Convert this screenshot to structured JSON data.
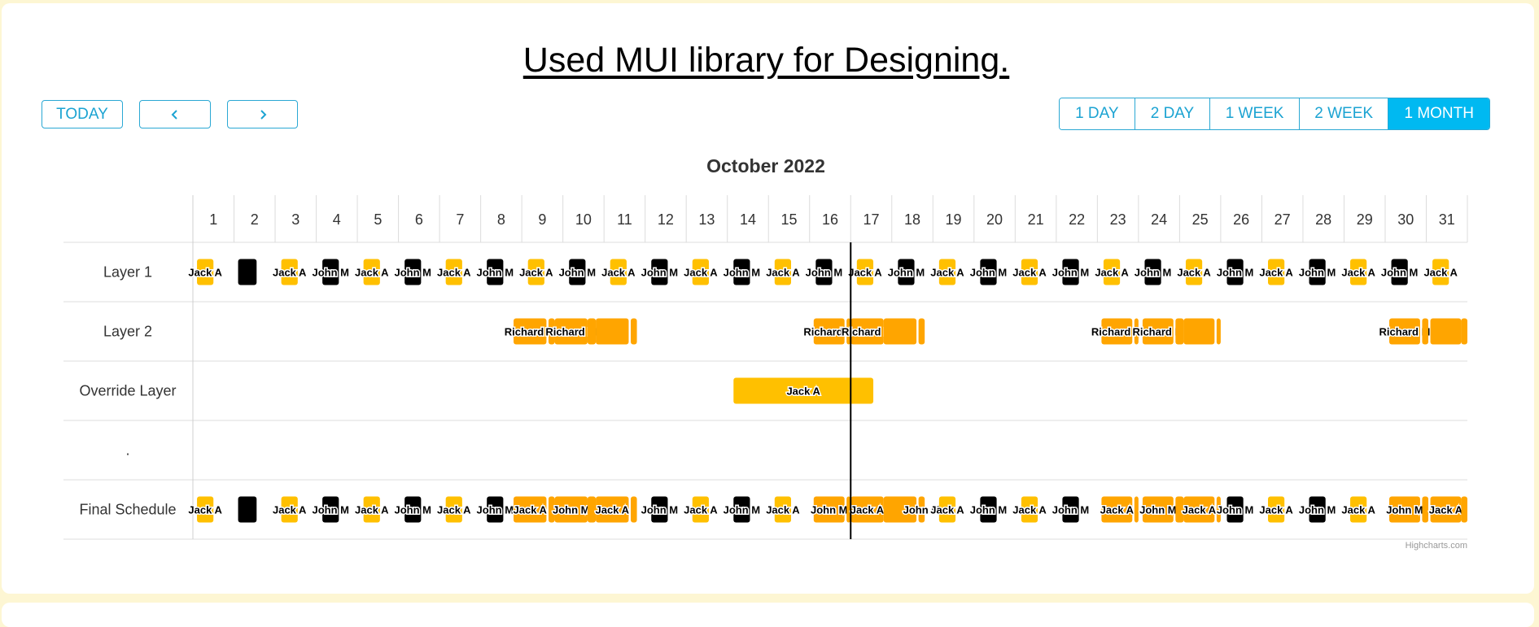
{
  "header": {
    "title": "Used MUI library for Designing."
  },
  "nav": {
    "today_label": "TODAY",
    "prev_icon": "chevron-left-icon",
    "next_icon": "chevron-right-icon"
  },
  "range_toggle": {
    "options": [
      "1 DAY",
      "2 DAY",
      "1 WEEK",
      "2 WEEK",
      "1 MONTH"
    ],
    "selected": "1 MONTH"
  },
  "colors": {
    "accent": "#00b9f1",
    "jack": "#ffc000",
    "john": "#000000",
    "richard": "#ffa500",
    "today_line": "#000000"
  },
  "credits": "Highcharts.com",
  "chart_data": {
    "type": "gantt",
    "title": "October 2022",
    "x_unit": "day of October 2022",
    "x_range": [
      1,
      32
    ],
    "days": [
      1,
      2,
      3,
      4,
      5,
      6,
      7,
      8,
      9,
      10,
      11,
      12,
      13,
      14,
      15,
      16,
      17,
      18,
      19,
      20,
      21,
      22,
      23,
      24,
      25,
      26,
      27,
      28,
      29,
      30,
      31
    ],
    "current_date_line": 17,
    "rows": [
      "Layer 1",
      "Layer 2",
      "Override Layer",
      ".",
      "Final Schedule"
    ],
    "series": [
      {
        "name": "Layer 1",
        "row": 0,
        "tasks": [
          {
            "label": "Jack A",
            "start": 1.1,
            "end": 1.5,
            "person": "jack"
          },
          {
            "label": "",
            "start": 2.1,
            "end": 2.55,
            "person": "john"
          },
          {
            "label": "Jack A",
            "start": 3.15,
            "end": 3.55,
            "person": "jack"
          },
          {
            "label": "John M",
            "start": 4.15,
            "end": 4.55,
            "person": "john"
          },
          {
            "label": "Jack A",
            "start": 5.15,
            "end": 5.55,
            "person": "jack"
          },
          {
            "label": "John M",
            "start": 6.15,
            "end": 6.55,
            "person": "john"
          },
          {
            "label": "Jack A",
            "start": 7.15,
            "end": 7.55,
            "person": "jack"
          },
          {
            "label": "John M",
            "start": 8.15,
            "end": 8.55,
            "person": "john"
          },
          {
            "label": "Jack A",
            "start": 9.15,
            "end": 9.55,
            "person": "jack"
          },
          {
            "label": "John M",
            "start": 10.15,
            "end": 10.55,
            "person": "john"
          },
          {
            "label": "Jack A",
            "start": 11.15,
            "end": 11.55,
            "person": "jack"
          },
          {
            "label": "John M",
            "start": 12.15,
            "end": 12.55,
            "person": "john"
          },
          {
            "label": "Jack A",
            "start": 13.15,
            "end": 13.55,
            "person": "jack"
          },
          {
            "label": "John M",
            "start": 14.15,
            "end": 14.55,
            "person": "john"
          },
          {
            "label": "Jack A",
            "start": 15.15,
            "end": 15.55,
            "person": "jack"
          },
          {
            "label": "John M",
            "start": 16.15,
            "end": 16.55,
            "person": "john"
          },
          {
            "label": "Jack A",
            "start": 17.15,
            "end": 17.55,
            "person": "jack"
          },
          {
            "label": "John M",
            "start": 18.15,
            "end": 18.55,
            "person": "john"
          },
          {
            "label": "Jack A",
            "start": 19.15,
            "end": 19.55,
            "person": "jack"
          },
          {
            "label": "John M",
            "start": 20.15,
            "end": 20.55,
            "person": "john"
          },
          {
            "label": "Jack A",
            "start": 21.15,
            "end": 21.55,
            "person": "jack"
          },
          {
            "label": "John M",
            "start": 22.15,
            "end": 22.55,
            "person": "john"
          },
          {
            "label": "Jack A",
            "start": 23.15,
            "end": 23.55,
            "person": "jack"
          },
          {
            "label": "John M",
            "start": 24.15,
            "end": 24.55,
            "person": "john"
          },
          {
            "label": "Jack A",
            "start": 25.15,
            "end": 25.55,
            "person": "jack"
          },
          {
            "label": "John M",
            "start": 26.15,
            "end": 26.55,
            "person": "john"
          },
          {
            "label": "Jack A",
            "start": 27.15,
            "end": 27.55,
            "person": "jack"
          },
          {
            "label": "John M",
            "start": 28.15,
            "end": 28.55,
            "person": "john"
          },
          {
            "label": "Jack A",
            "start": 29.15,
            "end": 29.55,
            "person": "jack"
          },
          {
            "label": "John M",
            "start": 30.15,
            "end": 30.55,
            "person": "john"
          },
          {
            "label": "Jack A",
            "start": 31.15,
            "end": 31.55,
            "person": "jack"
          }
        ]
      },
      {
        "name": "Layer 2",
        "row": 1,
        "tasks": [
          {
            "label": "Richard M",
            "start": 8.8,
            "end": 9.6,
            "person": "richard"
          },
          {
            "label": "",
            "start": 9.65,
            "end": 9.8,
            "person": "richard"
          },
          {
            "label": "Richard M",
            "start": 9.8,
            "end": 10.6,
            "person": "richard"
          },
          {
            "label": "",
            "start": 10.6,
            "end": 10.8,
            "person": "richard"
          },
          {
            "label": "",
            "start": 10.8,
            "end": 11.6,
            "person": "richard"
          },
          {
            "label": "",
            "start": 11.65,
            "end": 11.8,
            "person": "richard"
          },
          {
            "label": "Richard M",
            "start": 16.1,
            "end": 16.85,
            "person": "richard"
          },
          {
            "label": "",
            "start": 16.9,
            "end": 17,
            "person": "richard"
          },
          {
            "label": "Richard M",
            "start": 17,
            "end": 17.8,
            "person": "richard"
          },
          {
            "label": "",
            "start": 17.8,
            "end": 18.6,
            "person": "richard"
          },
          {
            "label": "",
            "start": 18.65,
            "end": 18.8,
            "person": "richard"
          },
          {
            "label": "Richard M",
            "start": 23.1,
            "end": 23.85,
            "person": "richard"
          },
          {
            "label": "",
            "start": 23.9,
            "end": 24,
            "person": "richard"
          },
          {
            "label": "Richard M",
            "start": 24.1,
            "end": 24.85,
            "person": "richard"
          },
          {
            "label": "",
            "start": 24.9,
            "end": 25.1,
            "person": "richard"
          },
          {
            "label": "",
            "start": 25.1,
            "end": 25.85,
            "person": "richard"
          },
          {
            "label": "",
            "start": 25.9,
            "end": 26,
            "person": "richard"
          },
          {
            "label": "Richard M",
            "start": 30.1,
            "end": 30.85,
            "person": "richard"
          },
          {
            "label": "",
            "start": 30.9,
            "end": 31.05,
            "person": "richard"
          },
          {
            "label": "",
            "start": 31.1,
            "end": 31.85,
            "person": "richard"
          },
          {
            "label": "",
            "start": 31.85,
            "end": 32,
            "person": "richard"
          }
        ]
      },
      {
        "name": "Override Layer",
        "row": 2,
        "tasks": [
          {
            "label": "Jack A",
            "start": 14.15,
            "end": 17.55,
            "person": "jack"
          }
        ]
      },
      {
        "name": "Final Schedule",
        "row": 4,
        "tasks": [
          {
            "label": "Jack A",
            "start": 1.1,
            "end": 1.5,
            "person": "jack"
          },
          {
            "label": "",
            "start": 2.1,
            "end": 2.55,
            "person": "john"
          },
          {
            "label": "Jack A",
            "start": 3.15,
            "end": 3.55,
            "person": "jack"
          },
          {
            "label": "John M",
            "start": 4.15,
            "end": 4.55,
            "person": "john"
          },
          {
            "label": "Jack A",
            "start": 5.15,
            "end": 5.55,
            "person": "jack"
          },
          {
            "label": "John M",
            "start": 6.15,
            "end": 6.55,
            "person": "john"
          },
          {
            "label": "Jack A",
            "start": 7.15,
            "end": 7.55,
            "person": "jack"
          },
          {
            "label": "John M",
            "start": 8.15,
            "end": 8.55,
            "person": "john"
          },
          {
            "label": "Jack A",
            "start": 8.8,
            "end": 9.6,
            "person": "richard"
          },
          {
            "label": "",
            "start": 9.65,
            "end": 9.8,
            "person": "richard"
          },
          {
            "label": "John M",
            "start": 9.8,
            "end": 10.6,
            "person": "richard"
          },
          {
            "label": "",
            "start": 10.6,
            "end": 10.8,
            "person": "richard"
          },
          {
            "label": "Jack A",
            "start": 10.8,
            "end": 11.6,
            "person": "richard"
          },
          {
            "label": "",
            "start": 11.65,
            "end": 11.8,
            "person": "richard"
          },
          {
            "label": "John M",
            "start": 12.15,
            "end": 12.55,
            "person": "john"
          },
          {
            "label": "Jack A",
            "start": 13.15,
            "end": 13.55,
            "person": "jack"
          },
          {
            "label": "John M",
            "start": 14.15,
            "end": 14.55,
            "person": "john"
          },
          {
            "label": "Jack A",
            "start": 15.15,
            "end": 15.55,
            "person": "jack"
          },
          {
            "label": "John M",
            "start": 16.1,
            "end": 16.85,
            "person": "richard"
          },
          {
            "label": "",
            "start": 16.9,
            "end": 17,
            "person": "richard"
          },
          {
            "label": "Jack A",
            "start": 17,
            "end": 17.8,
            "person": "richard"
          },
          {
            "label": "",
            "start": 17.8,
            "end": 18.6,
            "person": "richard"
          },
          {
            "label": "John M",
            "start": 18.65,
            "end": 18.8,
            "person": "richard"
          },
          {
            "label": "Jack A",
            "start": 19.15,
            "end": 19.55,
            "person": "jack"
          },
          {
            "label": "John M",
            "start": 20.15,
            "end": 20.55,
            "person": "john"
          },
          {
            "label": "Jack A",
            "start": 21.15,
            "end": 21.55,
            "person": "jack"
          },
          {
            "label": "John M",
            "start": 22.15,
            "end": 22.55,
            "person": "john"
          },
          {
            "label": "Jack A",
            "start": 23.1,
            "end": 23.85,
            "person": "richard"
          },
          {
            "label": "",
            "start": 23.9,
            "end": 24,
            "person": "richard"
          },
          {
            "label": "John M",
            "start": 24.1,
            "end": 24.85,
            "person": "richard"
          },
          {
            "label": "",
            "start": 24.9,
            "end": 25.1,
            "person": "richard"
          },
          {
            "label": "Jack A",
            "start": 25.1,
            "end": 25.85,
            "person": "richard"
          },
          {
            "label": "",
            "start": 25.9,
            "end": 26,
            "person": "richard"
          },
          {
            "label": "John M",
            "start": 26.15,
            "end": 26.55,
            "person": "john"
          },
          {
            "label": "Jack A",
            "start": 27.15,
            "end": 27.55,
            "person": "jack"
          },
          {
            "label": "John M",
            "start": 28.15,
            "end": 28.55,
            "person": "john"
          },
          {
            "label": "Jack A",
            "start": 29.15,
            "end": 29.55,
            "person": "jack"
          },
          {
            "label": "John M",
            "start": 30.1,
            "end": 30.85,
            "person": "richard"
          },
          {
            "label": "",
            "start": 30.9,
            "end": 31.05,
            "person": "richard"
          },
          {
            "label": "Jack A",
            "start": 31.1,
            "end": 31.85,
            "person": "richard"
          },
          {
            "label": "",
            "start": 31.85,
            "end": 32,
            "person": "richard"
          }
        ]
      }
    ]
  }
}
